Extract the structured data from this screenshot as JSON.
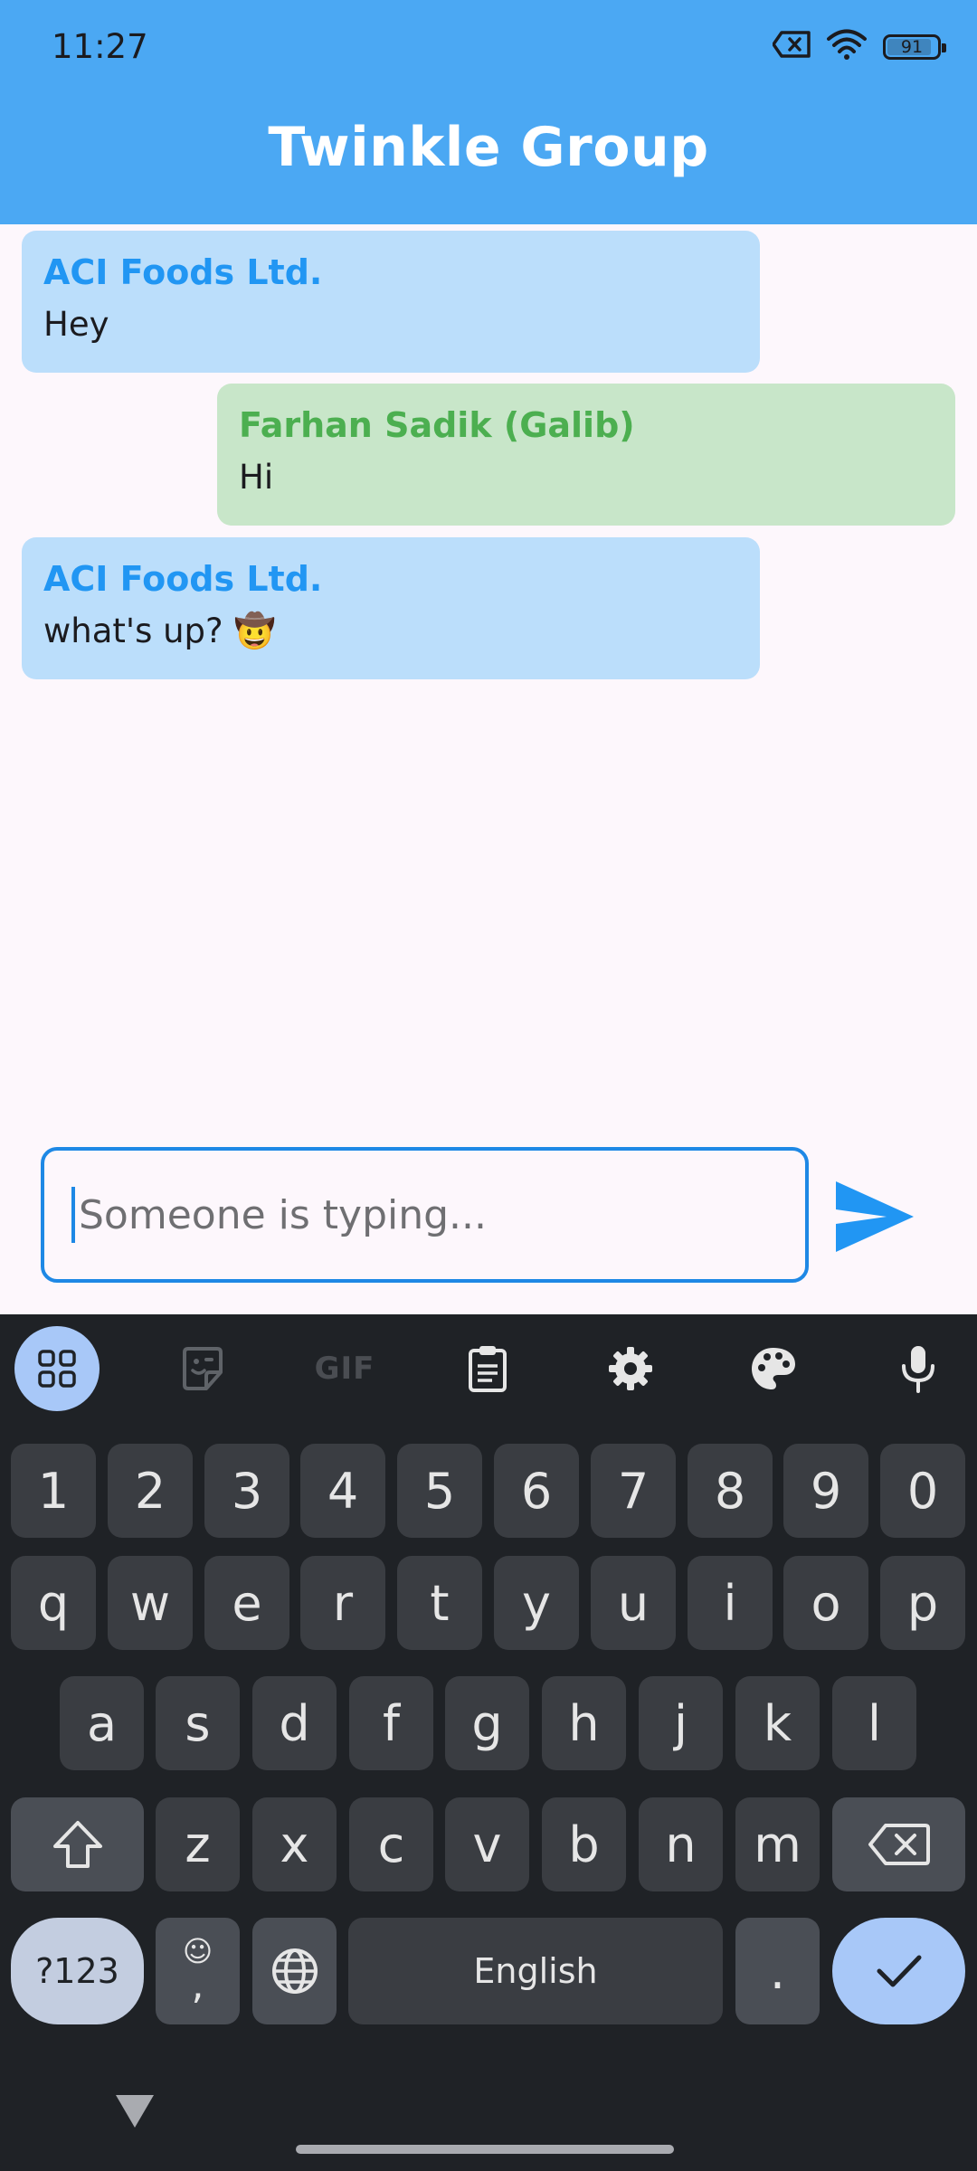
{
  "status_bar": {
    "time": "11:27",
    "battery": "91"
  },
  "app": {
    "title": "Twinkle Group"
  },
  "messages": [
    {
      "sender": "ACI Foods Ltd.",
      "text": "Hey",
      "side": "left"
    },
    {
      "sender": "Farhan Sadik (Galib)",
      "text": "Hi",
      "side": "right"
    },
    {
      "sender": "ACI Foods Ltd.",
      "text": "what's up? 🤠",
      "side": "left"
    }
  ],
  "composer": {
    "placeholder": "Someone is typing...",
    "value": ""
  },
  "keyboard": {
    "toolbar": {
      "gif_label": "GIF"
    },
    "row_numbers": [
      "1",
      "2",
      "3",
      "4",
      "5",
      "6",
      "7",
      "8",
      "9",
      "0"
    ],
    "row_1": [
      "q",
      "w",
      "e",
      "r",
      "t",
      "y",
      "u",
      "i",
      "o",
      "p"
    ],
    "row_2": [
      "a",
      "s",
      "d",
      "f",
      "g",
      "h",
      "j",
      "k",
      "l"
    ],
    "row_3": [
      "z",
      "x",
      "c",
      "v",
      "b",
      "n",
      "m"
    ],
    "symbols_label": "?123",
    "comma_emoji": "☺",
    "comma": ",",
    "space_label": "English",
    "period": "."
  },
  "colors": {
    "app_bar": "#4ba8f3",
    "left_bubble": "#bbdefb",
    "right_bubble": "#c8e6c9",
    "accent": "#1e88e5"
  }
}
